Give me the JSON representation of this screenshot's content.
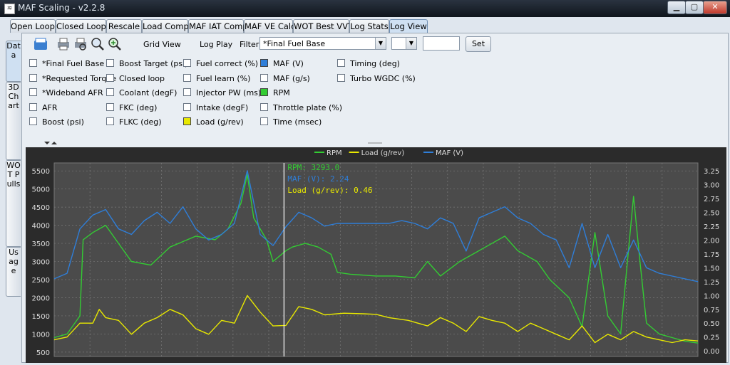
{
  "window": {
    "title": "MAF Scaling - v2.2.8",
    "icon": "app-icon"
  },
  "window_controls": [
    "minimize-icon",
    "maximize-icon",
    "close-icon"
  ],
  "tabs": [
    {
      "label": "Open Loop"
    },
    {
      "label": "Closed Loop"
    },
    {
      "label": "Rescale"
    },
    {
      "label": "Load Comp"
    },
    {
      "label": "MAF IAT Comp"
    },
    {
      "label": "MAF VE Calc"
    },
    {
      "label": "WOT Best VVT"
    },
    {
      "label": "Log Stats"
    },
    {
      "label": "Log View",
      "active": true
    }
  ],
  "side_tabs": [
    {
      "label": "Data",
      "active": true
    },
    {
      "label": "3D Chart"
    },
    {
      "label": "WOT Pulls"
    },
    {
      "label": "Usage"
    }
  ],
  "toolbar": {
    "icons": [
      "open-file-icon",
      "print-icon",
      "print-preview-icon",
      "zoom-icon",
      "zoom-fit-icon"
    ],
    "grid_view": "Grid View",
    "log_play": "Log Play",
    "filter_label": "Filter",
    "filter_value": "*Final Fuel Base",
    "compare_value": "",
    "filter_text": "",
    "set_label": "Set"
  },
  "columns": [
    {
      "label": "*Final Fuel Base",
      "checked": false
    },
    {
      "label": "*Requested Torque",
      "checked": false
    },
    {
      "label": "*Wideband AFR",
      "checked": false
    },
    {
      "label": "AFR",
      "checked": false
    },
    {
      "label": "Boost (psi)",
      "checked": false
    },
    {
      "label": "Boost Target (psi)",
      "checked": false
    },
    {
      "label": "Closed loop",
      "checked": false
    },
    {
      "label": "Coolant (degF)",
      "checked": false
    },
    {
      "label": "FKC (deg)",
      "checked": false
    },
    {
      "label": "FLKC (deg)",
      "checked": false
    },
    {
      "label": "Fuel correct (%)",
      "checked": false
    },
    {
      "label": "Fuel learn (%)",
      "checked": false
    },
    {
      "label": "Injector PW (ms)",
      "checked": false
    },
    {
      "label": "Intake (degF)",
      "checked": false
    },
    {
      "label": "Load (g/rev)",
      "checked": true,
      "color": "#e8e800"
    },
    {
      "label": "MAF (V)",
      "checked": true,
      "color": "#2f7ed8"
    },
    {
      "label": "MAF (g/s)",
      "checked": false
    },
    {
      "label": "RPM",
      "checked": true,
      "color": "#33cc33"
    },
    {
      "label": "Throttle plate (%)",
      "checked": false
    },
    {
      "label": "Time (msec)",
      "checked": false
    },
    {
      "label": "Timing (deg)",
      "checked": false
    },
    {
      "label": "Turbo WGDC (%)",
      "checked": false
    }
  ],
  "chart_data": {
    "type": "line",
    "left_axis": {
      "ticks": [
        "500",
        "1000",
        "1500",
        "2000",
        "2500",
        "3000",
        "3500",
        "4000",
        "4500",
        "5000",
        "5500"
      ],
      "range": [
        380,
        5720
      ]
    },
    "right_axis": {
      "ticks": [
        "0.00",
        "0.25",
        "0.50",
        "0.75",
        "1.00",
        "1.25",
        "1.50",
        "1.75",
        "2.00",
        "2.25",
        "2.50",
        "2.75",
        "3.00",
        "3.25"
      ],
      "range": [
        -0.1,
        3.39
      ]
    },
    "grid": true,
    "legend_position": "top-center",
    "cursor_fraction": 0.357,
    "readouts": [
      {
        "text": "RPM: 3293.0",
        "color": "#33cc33"
      },
      {
        "text": "MAF (V): 2.24",
        "color": "#2f7ed8"
      },
      {
        "text": "Load (g/rev): 0.46",
        "color": "#e8e800"
      }
    ],
    "series": [
      {
        "name": "RPM",
        "color": "#33cc33",
        "axis": "left",
        "points": [
          [
            0.0,
            900
          ],
          [
            0.02,
            1000
          ],
          [
            0.04,
            1500
          ],
          [
            0.045,
            3600
          ],
          [
            0.06,
            3800
          ],
          [
            0.08,
            4000
          ],
          [
            0.1,
            3500
          ],
          [
            0.12,
            3000
          ],
          [
            0.15,
            2900
          ],
          [
            0.18,
            3400
          ],
          [
            0.22,
            3700
          ],
          [
            0.25,
            3600
          ],
          [
            0.27,
            3900
          ],
          [
            0.29,
            4600
          ],
          [
            0.3,
            5400
          ],
          [
            0.31,
            4200
          ],
          [
            0.33,
            3600
          ],
          [
            0.34,
            3000
          ],
          [
            0.36,
            3300
          ],
          [
            0.37,
            3400
          ],
          [
            0.39,
            3500
          ],
          [
            0.41,
            3400
          ],
          [
            0.42,
            3300
          ],
          [
            0.43,
            3200
          ],
          [
            0.44,
            2700
          ],
          [
            0.46,
            2650
          ],
          [
            0.5,
            2600
          ],
          [
            0.53,
            2600
          ],
          [
            0.56,
            2550
          ],
          [
            0.58,
            3000
          ],
          [
            0.6,
            2600
          ],
          [
            0.63,
            3000
          ],
          [
            0.65,
            3200
          ],
          [
            0.67,
            3400
          ],
          [
            0.7,
            3700
          ],
          [
            0.72,
            3300
          ],
          [
            0.75,
            3000
          ],
          [
            0.77,
            2500
          ],
          [
            0.8,
            2000
          ],
          [
            0.82,
            1200
          ],
          [
            0.84,
            3800
          ],
          [
            0.86,
            1500
          ],
          [
            0.88,
            1000
          ],
          [
            0.9,
            4800
          ],
          [
            0.91,
            3000
          ],
          [
            0.92,
            1300
          ],
          [
            0.94,
            1000
          ],
          [
            0.96,
            900
          ],
          [
            0.98,
            800
          ],
          [
            1.0,
            750
          ]
        ]
      },
      {
        "name": "Load (g/rev)",
        "color": "#e8e800",
        "axis": "right",
        "points": [
          [
            0.0,
            0.2
          ],
          [
            0.02,
            0.25
          ],
          [
            0.04,
            0.5
          ],
          [
            0.06,
            0.5
          ],
          [
            0.07,
            0.75
          ],
          [
            0.08,
            0.6
          ],
          [
            0.1,
            0.55
          ],
          [
            0.12,
            0.3
          ],
          [
            0.14,
            0.5
          ],
          [
            0.16,
            0.6
          ],
          [
            0.18,
            0.75
          ],
          [
            0.2,
            0.65
          ],
          [
            0.22,
            0.4
          ],
          [
            0.24,
            0.3
          ],
          [
            0.26,
            0.55
          ],
          [
            0.28,
            0.5
          ],
          [
            0.3,
            1.0
          ],
          [
            0.32,
            0.7
          ],
          [
            0.34,
            0.45
          ],
          [
            0.36,
            0.46
          ],
          [
            0.38,
            0.8
          ],
          [
            0.4,
            0.75
          ],
          [
            0.42,
            0.65
          ],
          [
            0.45,
            0.68
          ],
          [
            0.48,
            0.67
          ],
          [
            0.5,
            0.66
          ],
          [
            0.52,
            0.6
          ],
          [
            0.55,
            0.55
          ],
          [
            0.58,
            0.45
          ],
          [
            0.6,
            0.6
          ],
          [
            0.62,
            0.5
          ],
          [
            0.64,
            0.35
          ],
          [
            0.66,
            0.62
          ],
          [
            0.68,
            0.55
          ],
          [
            0.7,
            0.5
          ],
          [
            0.72,
            0.35
          ],
          [
            0.74,
            0.5
          ],
          [
            0.76,
            0.4
          ],
          [
            0.78,
            0.3
          ],
          [
            0.8,
            0.2
          ],
          [
            0.82,
            0.45
          ],
          [
            0.84,
            0.15
          ],
          [
            0.86,
            0.3
          ],
          [
            0.88,
            0.2
          ],
          [
            0.9,
            0.35
          ],
          [
            0.92,
            0.25
          ],
          [
            0.94,
            0.2
          ],
          [
            0.96,
            0.15
          ],
          [
            0.98,
            0.2
          ],
          [
            1.0,
            0.18
          ]
        ]
      },
      {
        "name": "MAF (V)",
        "color": "#2f7ed8",
        "axis": "right",
        "points": [
          [
            0.0,
            1.3
          ],
          [
            0.02,
            1.4
          ],
          [
            0.04,
            2.2
          ],
          [
            0.06,
            2.45
          ],
          [
            0.08,
            2.55
          ],
          [
            0.1,
            2.2
          ],
          [
            0.12,
            2.1
          ],
          [
            0.14,
            2.35
          ],
          [
            0.16,
            2.5
          ],
          [
            0.18,
            2.3
          ],
          [
            0.2,
            2.6
          ],
          [
            0.22,
            2.2
          ],
          [
            0.24,
            2.0
          ],
          [
            0.26,
            2.1
          ],
          [
            0.28,
            2.3
          ],
          [
            0.3,
            3.25
          ],
          [
            0.32,
            2.1
          ],
          [
            0.34,
            1.9
          ],
          [
            0.36,
            2.24
          ],
          [
            0.38,
            2.5
          ],
          [
            0.4,
            2.4
          ],
          [
            0.42,
            2.25
          ],
          [
            0.44,
            2.3
          ],
          [
            0.46,
            2.3
          ],
          [
            0.5,
            2.3
          ],
          [
            0.52,
            2.3
          ],
          [
            0.54,
            2.35
          ],
          [
            0.56,
            2.3
          ],
          [
            0.58,
            2.2
          ],
          [
            0.6,
            2.4
          ],
          [
            0.62,
            2.3
          ],
          [
            0.64,
            1.8
          ],
          [
            0.66,
            2.4
          ],
          [
            0.68,
            2.5
          ],
          [
            0.7,
            2.6
          ],
          [
            0.72,
            2.4
          ],
          [
            0.74,
            2.3
          ],
          [
            0.76,
            2.1
          ],
          [
            0.78,
            2.0
          ],
          [
            0.8,
            1.5
          ],
          [
            0.82,
            2.3
          ],
          [
            0.84,
            1.5
          ],
          [
            0.86,
            2.1
          ],
          [
            0.88,
            1.5
          ],
          [
            0.9,
            2.0
          ],
          [
            0.92,
            1.5
          ],
          [
            0.94,
            1.4
          ],
          [
            0.96,
            1.35
          ],
          [
            0.98,
            1.3
          ],
          [
            1.0,
            1.25
          ]
        ]
      }
    ]
  }
}
